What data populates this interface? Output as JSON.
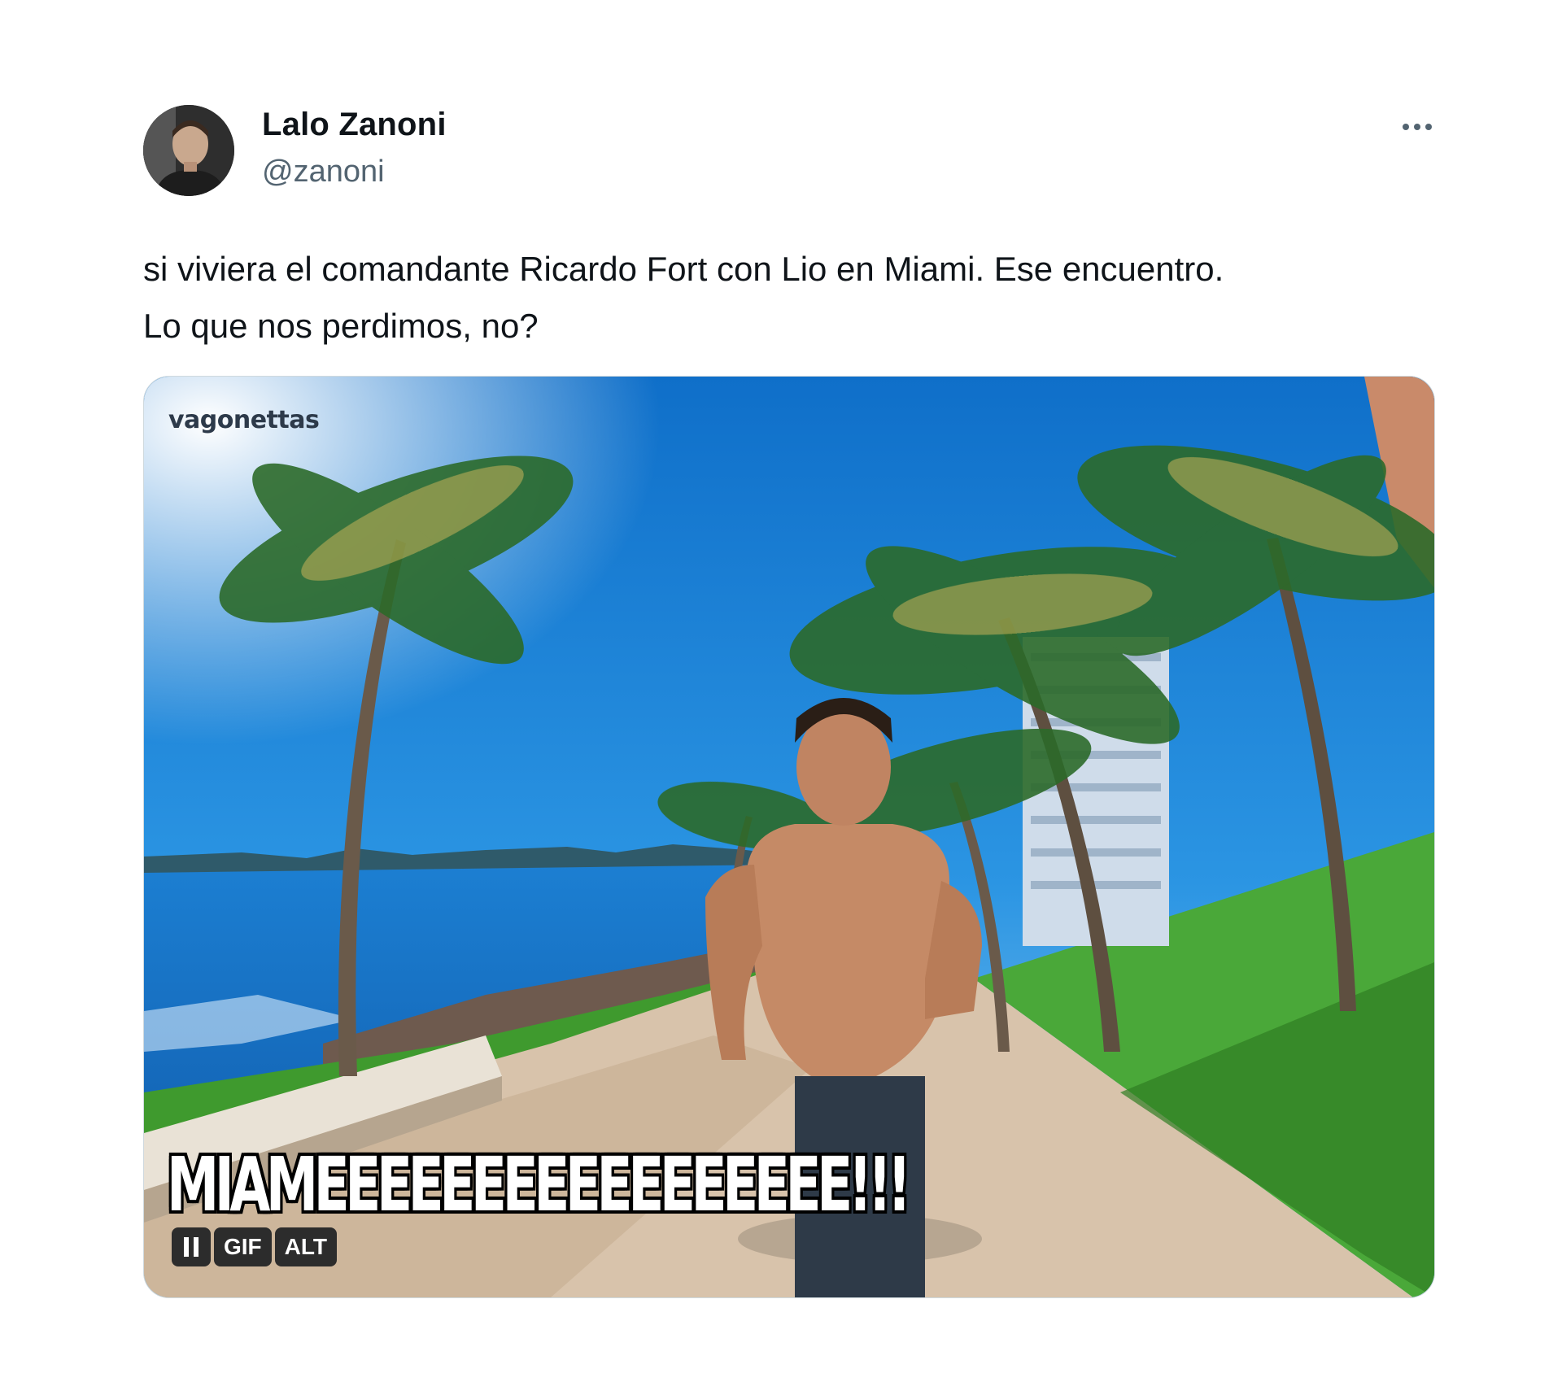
{
  "author": {
    "name": "Lalo Zanoni",
    "handle": "@zanoni"
  },
  "tweet": {
    "text_lines": [
      "si viviera el comandante Ricardo Fort con Lio en Miami. Ese encuentro.",
      "Lo que nos perdimos, no?"
    ]
  },
  "media": {
    "watermark": "vagonettas",
    "caption": "MIAMEEEEEEEEEEEEEEEEE!!!",
    "badges": {
      "gif": "GIF",
      "alt": "ALT"
    }
  },
  "icons": {
    "more": "more-horizontal-icon",
    "pause": "pause-icon"
  },
  "colors": {
    "text_primary": "#0f1419",
    "text_secondary": "#536471",
    "media_border": "#cfd9de"
  }
}
